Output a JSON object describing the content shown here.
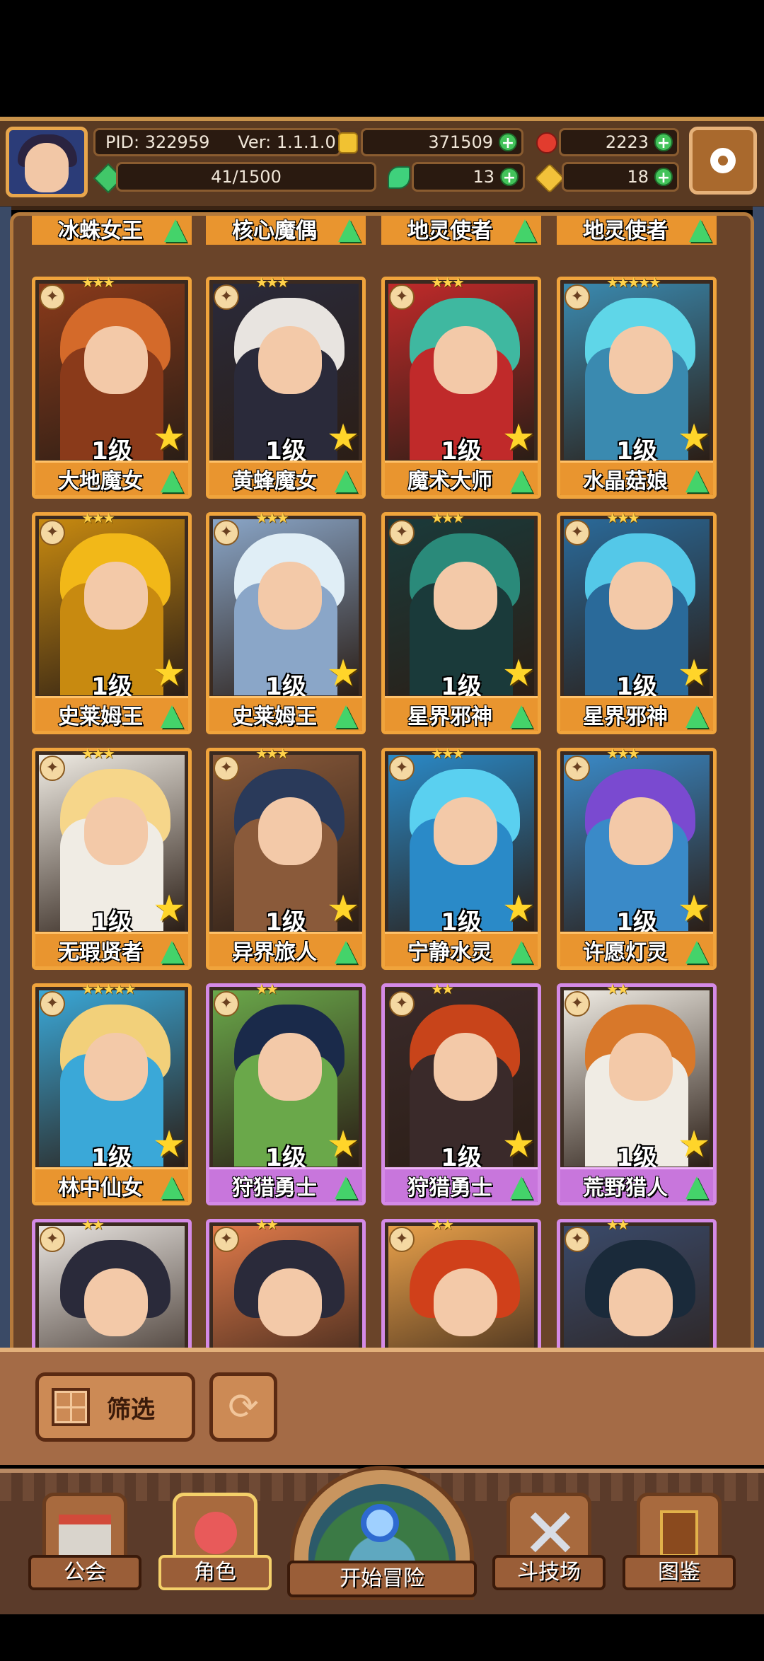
{
  "header": {
    "pid": "PID: 322959",
    "version": "Ver: 1.1.1.0",
    "exp": "41/1500",
    "gold": "371509",
    "ruby": "2223",
    "clover": "13",
    "keys": "18"
  },
  "top_row": [
    {
      "name": "冰蛛女王"
    },
    {
      "name": "核心魔偶"
    },
    {
      "name": "地灵使者"
    },
    {
      "name": "地灵使者"
    }
  ],
  "cards": [
    {
      "name": "大地魔女",
      "level": "1级",
      "stars": "★★★",
      "frame": "gold",
      "palette": [
        "#d46a2a",
        "#8a3a1a"
      ]
    },
    {
      "name": "黄蜂魔女",
      "level": "1级",
      "stars": "★★★",
      "frame": "gold",
      "palette": [
        "#e8e4e0",
        "#2a2a3a"
      ]
    },
    {
      "name": "魔术大师",
      "level": "1级",
      "stars": "★★★",
      "frame": "gold",
      "palette": [
        "#3fb8a0",
        "#c02a2a"
      ]
    },
    {
      "name": "水晶菇娘",
      "level": "1级",
      "stars": "★★★★★",
      "frame": "gold",
      "palette": [
        "#5fd6e8",
        "#3a8ab0"
      ]
    },
    {
      "name": "史莱姆王",
      "level": "1级",
      "stars": "★★★",
      "frame": "gold",
      "palette": [
        "#f2b818",
        "#c88a10"
      ]
    },
    {
      "name": "史莱姆王",
      "level": "1级",
      "stars": "★★★",
      "frame": "gold",
      "palette": [
        "#e0eef6",
        "#8aa6c8"
      ]
    },
    {
      "name": "星界邪神",
      "level": "1级",
      "stars": "★★★",
      "frame": "gold",
      "palette": [
        "#2a8a7a",
        "#1a3a3a"
      ]
    },
    {
      "name": "星界邪神",
      "level": "1级",
      "stars": "★★★",
      "frame": "gold",
      "palette": [
        "#54c8e8",
        "#2a6a9a"
      ]
    },
    {
      "name": "无瑕贤者",
      "level": "1级",
      "stars": "★★★",
      "frame": "gold",
      "palette": [
        "#f6d68a",
        "#f0ece4"
      ]
    },
    {
      "name": "异界旅人",
      "level": "1级",
      "stars": "★★★",
      "frame": "gold",
      "palette": [
        "#2a3a5a",
        "#8a5a3a"
      ]
    },
    {
      "name": "宁静水灵",
      "level": "1级",
      "stars": "★★★",
      "frame": "gold",
      "palette": [
        "#5ad0f0",
        "#2a8ac8"
      ]
    },
    {
      "name": "许愿灯灵",
      "level": "1级",
      "stars": "★★★",
      "frame": "gold",
      "palette": [
        "#7a4ad0",
        "#3a8ac8"
      ]
    },
    {
      "name": "林中仙女",
      "level": "1级",
      "stars": "★★★★★",
      "frame": "gold",
      "palette": [
        "#f2d07a",
        "#3aa8d8"
      ]
    },
    {
      "name": "狩猎勇士",
      "level": "1级",
      "stars": "★★",
      "frame": "purple",
      "palette": [
        "#1a2a4a",
        "#6aa84a"
      ]
    },
    {
      "name": "狩猎勇士",
      "level": "1级",
      "stars": "★★",
      "frame": "purple",
      "palette": [
        "#c8441a",
        "#3a2a2a"
      ]
    },
    {
      "name": "荒野猎人",
      "level": "1级",
      "stars": "★★",
      "frame": "purple",
      "palette": [
        "#d8782a",
        "#f0ece4"
      ]
    }
  ],
  "partial_row": [
    {
      "stars": "★★",
      "palette": [
        "#2a2a3a",
        "#e8e4e0"
      ]
    },
    {
      "stars": "★★",
      "palette": [
        "#2a2a3a",
        "#e07a4a"
      ]
    },
    {
      "stars": "★★",
      "palette": [
        "#d0401a",
        "#e8a04a"
      ]
    },
    {
      "stars": "★★",
      "palette": [
        "#1a2a3a",
        "#3a4a6a"
      ]
    }
  ],
  "toolbar": {
    "filter_label": "筛选"
  },
  "nav": {
    "guild": "公会",
    "character": "角色",
    "adventure": "开始冒险",
    "arena": "斗技场",
    "codex": "图鉴"
  }
}
